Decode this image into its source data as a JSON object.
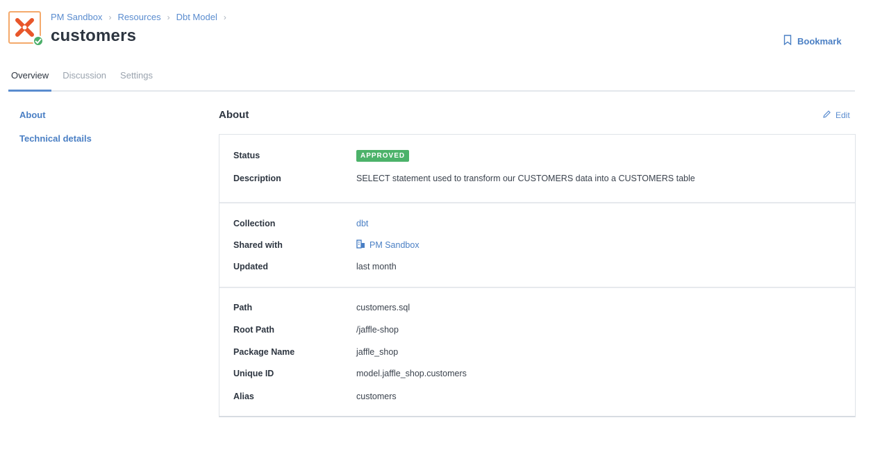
{
  "breadcrumb": [
    "PM Sandbox",
    "Resources",
    "Dbt Model"
  ],
  "breadcrumb_separator": "›",
  "page_title": "customers",
  "header": {
    "bookmark_label": "Bookmark"
  },
  "tabs": [
    {
      "label": "Overview",
      "active": true
    },
    {
      "label": "Discussion",
      "active": false
    },
    {
      "label": "Settings",
      "active": false
    }
  ],
  "sidenav": [
    "About",
    "Technical details"
  ],
  "section": {
    "title": "About",
    "edit_label": "Edit"
  },
  "details": {
    "status": {
      "label": "Status",
      "value": "APPROVED"
    },
    "description": {
      "label": "Description",
      "value": "SELECT statement used to transform our CUSTOMERS data into a CUSTOMERS table"
    },
    "collection": {
      "label": "Collection",
      "value": "dbt"
    },
    "shared_with": {
      "label": "Shared with",
      "value": "PM Sandbox"
    },
    "updated": {
      "label": "Updated",
      "value": "last month"
    },
    "path": {
      "label": "Path",
      "value": "customers.sql"
    },
    "root_path": {
      "label": "Root Path",
      "value": "/jaffle-shop"
    },
    "package_name": {
      "label": "Package Name",
      "value": "jaffle_shop"
    },
    "unique_id": {
      "label": "Unique ID",
      "value": "model.jaffle_shop.customers"
    },
    "alias": {
      "label": "Alias",
      "value": "customers"
    }
  },
  "icons": {
    "logo": "dbt-logo-icon",
    "verified": "check-icon",
    "bookmark": "bookmark-icon",
    "edit": "pencil-icon",
    "shared": "building-icon"
  },
  "colors": {
    "accent": "#4a7fc4",
    "approved": "#4cb26a",
    "logo": "#e8562a"
  }
}
